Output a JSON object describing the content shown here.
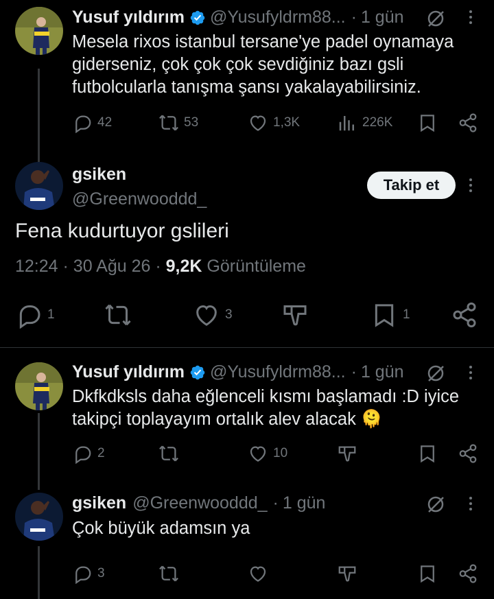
{
  "tweets": [
    {
      "name": "Yusuf yıldırım",
      "handle": "@Yusufyldrm88...",
      "sep": "·",
      "time": "1 gün",
      "text": [
        "Mesela rixos istanbul tersane'ye padel oynamaya",
        "giderseniz, çok çok çok sevdiğiniz bazı gsli",
        "futbolcularla tanışma şansı yakalayabilirsiniz."
      ],
      "replies": "42",
      "retweets": "53",
      "likes": "1,3K",
      "views": "226K"
    },
    {
      "name": "Yusuf yıldırım",
      "handle": "@Yusufyldrm88...",
      "sep": "·",
      "time": "1 gün",
      "text": [
        "Dkfkdksls daha eğlenceli kısmı başlamadı :D iyice",
        "takipçi toplayayım ortalık alev alacak 🫠"
      ],
      "replies": "2",
      "likes": "10"
    },
    {
      "name": "gsiken",
      "handle": "@Greenwooddd_",
      "sep": "·",
      "time": "1 gün",
      "text": [
        "Çok büyük adamsın ya"
      ],
      "replies": "3"
    }
  ],
  "main_tweet": {
    "name": "gsiken",
    "handle": "@Greenwooddd_",
    "follow_label": "Takip et",
    "text": "Fena kudurtuyor gslileri",
    "time": "12:24",
    "date": "30 Ağu 26",
    "views_count": "9,2K",
    "views_label": "Görüntüleme",
    "replies": "1",
    "likes": "3",
    "bookmarks": "1"
  },
  "colors": {
    "background": "#000000",
    "text": "#e7e9ea",
    "muted": "#71767b",
    "verified": "#1d9bf0",
    "follow_bg": "#eff3f4"
  }
}
